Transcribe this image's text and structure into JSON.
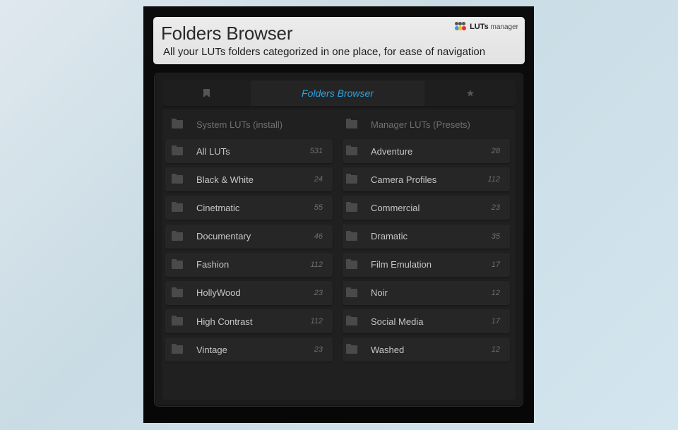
{
  "header": {
    "title": "Folders Browser",
    "subtitle": "All your LUTs folders categorized in one place, for ease of navigation",
    "brand_bold": "LUTs",
    "brand_light": "manager"
  },
  "tabs": {
    "left_icon": "bookmark-icon",
    "active_label": "Folders Browser",
    "right_icon": "star-icon",
    "accent_color": "#2ea3e0"
  },
  "columns": {
    "left": {
      "header": "System LUTs (install)",
      "items": [
        {
          "label": "All LUTs",
          "count": "531"
        },
        {
          "label": "Black & White",
          "count": "24"
        },
        {
          "label": "Cinetmatic",
          "count": "55"
        },
        {
          "label": "Documentary",
          "count": "46"
        },
        {
          "label": "Fashion",
          "count": "112"
        },
        {
          "label": "HollyWood",
          "count": "23"
        },
        {
          "label": "High Contrast",
          "count": "112"
        },
        {
          "label": "Vintage",
          "count": "23"
        }
      ]
    },
    "right": {
      "header": "Manager LUTs (Presets)",
      "items": [
        {
          "label": "Adventure",
          "count": "28"
        },
        {
          "label": "Camera Profiles",
          "count": "112"
        },
        {
          "label": "Commercial",
          "count": "23"
        },
        {
          "label": "Dramatic",
          "count": "35"
        },
        {
          "label": "Film Emulation",
          "count": "17"
        },
        {
          "label": "Noir",
          "count": "12"
        },
        {
          "label": "Social Media",
          "count": "17"
        },
        {
          "label": "Washed",
          "count": "12"
        }
      ]
    }
  }
}
